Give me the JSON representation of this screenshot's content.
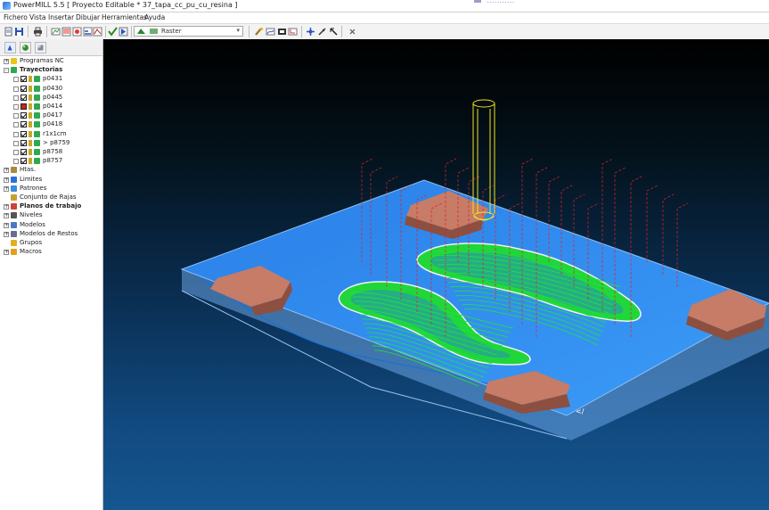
{
  "window": {
    "title": "PowerMILL 5.5   [ Proyecto Editable * 37_tapa_cc_pu_cu_resina ]",
    "ghost_text": "..........."
  },
  "menu": [
    "Fichero",
    "Vista",
    "Insertar",
    "Dibujar",
    "Herramientas",
    "Ayuda"
  ],
  "toolbar": {
    "strategy_value": "Raster"
  },
  "explorer": {
    "tree": [
      {
        "label": "Programas NC",
        "bold": false,
        "level": 0,
        "icon": "nc-program-icon",
        "expander": "+"
      },
      {
        "label": "Trayectorias",
        "bold": true,
        "level": 0,
        "icon": "toolpaths-icon",
        "expander": "-"
      },
      {
        "label": "p0431",
        "level": 1,
        "checked": true,
        "icon": "toolpath-icon"
      },
      {
        "label": "p0430",
        "level": 1,
        "checked": true,
        "icon": "toolpath-icon"
      },
      {
        "label": "p0445",
        "level": 1,
        "checked": true,
        "icon": "toolpath-icon"
      },
      {
        "label": "p0414",
        "level": 1,
        "checked": false,
        "red": true,
        "icon": "toolpath-icon"
      },
      {
        "label": "p0417",
        "level": 1,
        "checked": true,
        "icon": "toolpath-icon"
      },
      {
        "label": "p0418",
        "level": 1,
        "checked": true,
        "icon": "toolpath-icon"
      },
      {
        "label": "r1x1cm",
        "level": 1,
        "checked": true,
        "icon": "toolpath-icon"
      },
      {
        "label": "> p8759",
        "level": 1,
        "checked": true,
        "icon": "toolpath-icon"
      },
      {
        "label": "p8758",
        "level": 1,
        "checked": true,
        "icon": "toolpath-icon"
      },
      {
        "label": "p8757",
        "level": 1,
        "checked": true,
        "icon": "toolpath-icon"
      },
      {
        "label": "Htas.",
        "bold": false,
        "level": 0,
        "icon": "tools-icon",
        "expander": "+"
      },
      {
        "label": "Limites",
        "bold": false,
        "level": 0,
        "icon": "boundaries-icon",
        "expander": "+"
      },
      {
        "label": "Patrones",
        "bold": false,
        "level": 0,
        "icon": "patterns-icon",
        "expander": "+"
      },
      {
        "label": "Conjunto de Rajas",
        "bold": false,
        "level": 0,
        "icon": "feature-sets-icon",
        "expander": ""
      },
      {
        "label": "Planos de trabajo",
        "bold": true,
        "level": 0,
        "icon": "workplanes-icon",
        "expander": "+"
      },
      {
        "label": "Niveles",
        "bold": false,
        "level": 0,
        "icon": "levels-icon",
        "expander": "+"
      },
      {
        "label": "Modelos",
        "bold": false,
        "level": 0,
        "icon": "models-icon",
        "expander": "+"
      },
      {
        "label": "Modelos de Restos",
        "bold": false,
        "level": 0,
        "icon": "stock-models-icon",
        "expander": "+"
      },
      {
        "label": "Grupos",
        "bold": false,
        "level": 0,
        "icon": "groups-icon",
        "expander": ""
      },
      {
        "label": "Macros",
        "bold": false,
        "level": 0,
        "icon": "macros-icon",
        "expander": "+"
      }
    ]
  },
  "colors": {
    "plate": "#2f8cf0",
    "plate_side": "#5a9be0",
    "pad": "#c8826b",
    "toolpath_green": "#1fe53a",
    "toolpath_red": "#e0202a",
    "tool_yellow": "#f3e21a"
  }
}
